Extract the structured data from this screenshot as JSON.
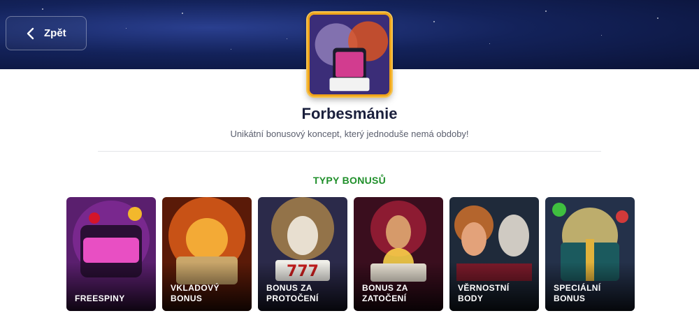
{
  "header": {
    "back_label": "Zpět"
  },
  "promo": {
    "title": "Forbesmánie",
    "subtitle": "Unikátní bonusový koncept, který jednoduše nemá obdoby!"
  },
  "bonus_types": {
    "heading": "TYPY BONUSŮ",
    "items": [
      {
        "label": "FREESPINY"
      },
      {
        "label": "VKLADOVÝ\nBONUS"
      },
      {
        "label": "BONUS ZA\nPROTOČENÍ"
      },
      {
        "label": "BONUS ZA\nZATOČENÍ"
      },
      {
        "label": "VĚRNOSTNÍ\nBODY"
      },
      {
        "label": "SPECIÁLNÍ\nBONUS"
      }
    ]
  },
  "colors": {
    "heading_green": "#1f8f2a",
    "hero_navy": "#13225a",
    "thumb_border": "#f0a51a"
  }
}
